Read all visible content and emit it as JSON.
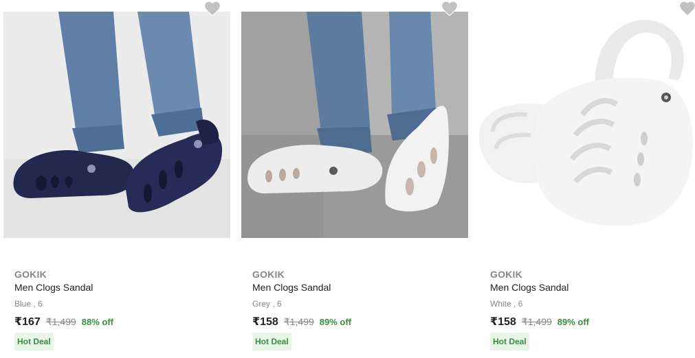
{
  "colors": {
    "brand_text": "#878787",
    "title_text": "#212121",
    "discount": "#388e3c",
    "deal_bg": "#e8f5e9",
    "wishlist_icon": "#c2c2c2"
  },
  "products": [
    {
      "image_alt": "navy clogs",
      "wishlist_icon": "heart-icon",
      "brand": "GOKIK",
      "title": "Men Clogs Sandal",
      "variant": "Blue , 6",
      "price": "₹167",
      "mrp": "₹1,499",
      "discount": "88% off",
      "badge": "Hot Deal"
    },
    {
      "image_alt": "grey clogs",
      "wishlist_icon": "heart-icon",
      "brand": "GOKIK",
      "title": "Men Clogs Sandal",
      "variant": "Grey , 6",
      "price": "₹158",
      "mrp": "₹1,499",
      "discount": "89% off",
      "badge": "Hot Deal"
    },
    {
      "image_alt": "white clogs",
      "wishlist_icon": "heart-icon",
      "brand": "GOKIK",
      "title": "Men Clogs Sandal",
      "variant": "White , 6",
      "price": "₹158",
      "mrp": "₹1,499",
      "discount": "89% off",
      "badge": "Hot Deal"
    }
  ]
}
